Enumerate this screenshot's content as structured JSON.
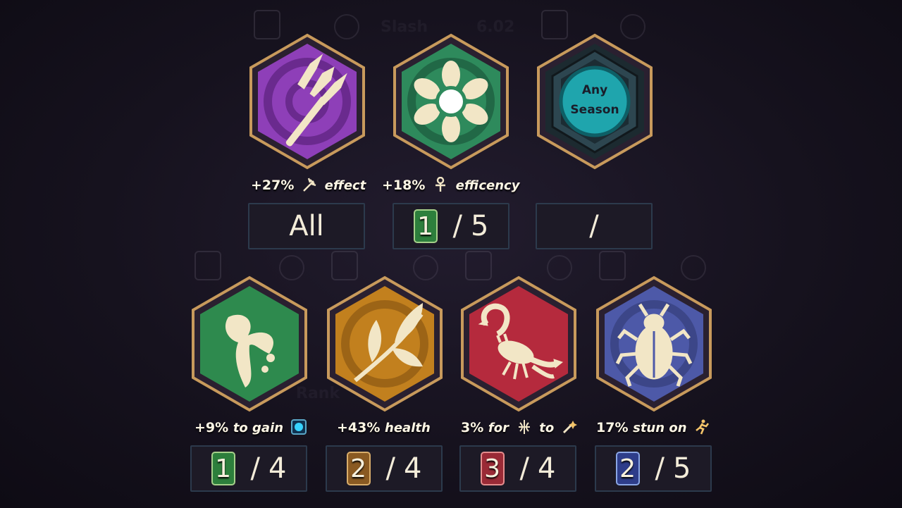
{
  "colors": {
    "background": "#16121e",
    "gold_border": "#c89a5c",
    "text": "#f3ecd9"
  },
  "background_ghost": {
    "label1": "Slash",
    "label2": "6.02",
    "label3": "Rank"
  },
  "badges_top": [
    {
      "name": "trident-ability",
      "icon": "trident-icon",
      "bonus_value": "+27%",
      "bonus_text": "effect",
      "bonus_icon": "trident-small-icon",
      "counter_text": "All",
      "color": "#8e3fb8"
    },
    {
      "name": "flower-ability",
      "icon": "flower-icon",
      "bonus_value": "+18%",
      "bonus_text": "efficency",
      "bonus_icon": "ankh-icon",
      "counter_current": "1",
      "counter_sep": "/",
      "counter_total": "5",
      "color": "#2e8a5c"
    },
    {
      "name": "season-ability",
      "icon": "season-icon",
      "season_line1": "Any",
      "season_line2": "Season",
      "counter_text": "/",
      "color": "#1f8e97"
    }
  ],
  "badges_bottom": [
    {
      "name": "dragon-ability",
      "icon": "dragon-icon",
      "bonus_value": "+9%",
      "bonus_text": "to gain",
      "bonus_icon": "cyan-gem-icon",
      "counter_current": "1",
      "counter_sep": "/",
      "counter_total": "4",
      "color": "#2e8a4e"
    },
    {
      "name": "leaf-ability",
      "icon": "leaf-icon",
      "bonus_value": "+43%",
      "bonus_text": "health",
      "counter_current": "2",
      "counter_sep": "/",
      "counter_total": "4",
      "color": "#c2801e"
    },
    {
      "name": "scorpion-ability",
      "icon": "scorpion-icon",
      "bonus_value": "3%",
      "bonus_text_a": "for",
      "bonus_text_b": "to",
      "bonus_icon_a": "bow-icon",
      "bonus_icon_b": "wand-icon",
      "counter_current": "3",
      "counter_sep": "/",
      "counter_total": "4",
      "color": "#b52a3d"
    },
    {
      "name": "beetle-ability",
      "icon": "beetle-icon",
      "bonus_value": "17%",
      "bonus_text": "stun on",
      "bonus_icon": "runner-icon",
      "counter_current": "2",
      "counter_sep": "/",
      "counter_total": "5",
      "color": "#4d59a8"
    }
  ]
}
